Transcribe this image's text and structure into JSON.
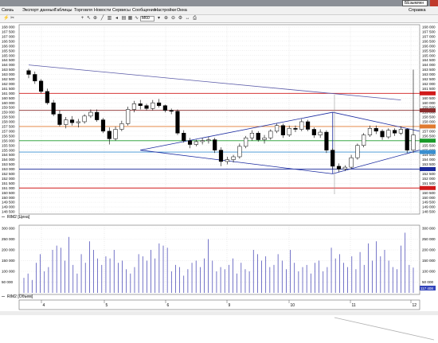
{
  "window": {
    "title": "БЕзымянн"
  },
  "menu": {
    "items": [
      "Связь",
      "Экспорт данных",
      "Таблицы",
      "Торговля",
      "Новости",
      "Сервисы",
      "Сообщения",
      "Настройки",
      "Окна"
    ],
    "right": "Справка"
  },
  "toolbar": {
    "timeframe": "M60"
  },
  "price_panel": {
    "label": "RIM2 [Цена]",
    "y_ticks": [
      "168 000",
      "167 500",
      "167 000",
      "166 500",
      "166 000",
      "165 500",
      "165 000",
      "164 500",
      "164 000",
      "163 500",
      "163 000",
      "162 500",
      "162 000",
      "161 500",
      "161 000",
      "160 500",
      "160 000",
      "159 500",
      "159 000",
      "158 500",
      "158 000",
      "157 500",
      "157 000",
      "156 500",
      "156 000",
      "155 500",
      "155 000",
      "154 500",
      "154 000",
      "153 500",
      "153 000",
      "152 500",
      "152 000",
      "151 500",
      "151 000",
      "150 500",
      "150 000",
      "149 500",
      "149 000",
      "148 500"
    ],
    "levels": [
      {
        "price": 161000,
        "color": "#d11a1a"
      },
      {
        "price": 159200,
        "color": "#8a2b2b"
      },
      {
        "price": 157500,
        "color": "#e07a30"
      },
      {
        "price": 156000,
        "color": "#1a9a2a"
      },
      {
        "price": 154800,
        "color": "#3a8fd0"
      },
      {
        "price": 153000,
        "color": "#1a2a9a"
      },
      {
        "price": 151000,
        "color": "#d11a1a"
      }
    ]
  },
  "volume_panel": {
    "label": "RIM2 [Объем]",
    "y_ticks": [
      "300 000",
      "250 000",
      "200 000",
      "150 000",
      "100 000",
      "50 000"
    ],
    "last_value": "117 408"
  },
  "date_axis": {
    "labels": [
      "4",
      "5",
      "6",
      "9",
      "10",
      "11",
      "12"
    ]
  },
  "chart_data": [
    {
      "type": "candlestick",
      "title": "",
      "series": [
        {
          "name": "RIM2 [Цена]"
        }
      ],
      "ylim": [
        148500,
        168000
      ],
      "candles": [
        [
          163400,
          163600,
          162600,
          163000
        ],
        [
          163000,
          163300,
          162000,
          162300
        ],
        [
          162300,
          162500,
          161000,
          161200
        ],
        [
          161200,
          161500,
          159800,
          160000
        ],
        [
          160000,
          160300,
          158600,
          158800
        ],
        [
          158800,
          159200,
          157500,
          157700
        ],
        [
          157700,
          158500,
          157300,
          158200
        ],
        [
          158200,
          158600,
          157600,
          157900
        ],
        [
          157900,
          158300,
          157400,
          158000
        ],
        [
          158000,
          158800,
          157800,
          158600
        ],
        [
          158600,
          159300,
          158400,
          159000
        ],
        [
          159000,
          159300,
          158000,
          158200
        ],
        [
          158200,
          158400,
          156800,
          157000
        ],
        [
          157000,
          157400,
          155600,
          156200
        ],
        [
          156200,
          157500,
          156000,
          157200
        ],
        [
          157200,
          158100,
          157000,
          157800
        ],
        [
          157800,
          159600,
          157600,
          159300
        ],
        [
          159300,
          160200,
          159000,
          159900
        ],
        [
          159900,
          160300,
          159300,
          159700
        ],
        [
          159700,
          159900,
          159200,
          159400
        ],
        [
          159400,
          160300,
          159200,
          160000
        ],
        [
          160000,
          160400,
          159500,
          159700
        ],
        [
          159700,
          159800,
          159000,
          159200
        ],
        [
          159200,
          159400,
          158800,
          159100
        ],
        [
          159100,
          159300,
          156600,
          156800
        ],
        [
          156800,
          157100,
          155800,
          156000
        ],
        [
          156000,
          156300,
          155200,
          155600
        ],
        [
          155600,
          156100,
          155400,
          155900
        ],
        [
          155900,
          156300,
          155600,
          156000
        ],
        [
          156000,
          156400,
          155700,
          156100
        ],
        [
          156100,
          156300,
          154700,
          155000
        ],
        [
          155000,
          155300,
          153300,
          153800
        ],
        [
          153800,
          154300,
          153500,
          154000
        ],
        [
          154000,
          154500,
          153700,
          154300
        ],
        [
          154300,
          155700,
          154100,
          155400
        ],
        [
          155400,
          156500,
          155200,
          156300
        ],
        [
          156300,
          157100,
          156000,
          156800
        ],
        [
          156800,
          157000,
          155900,
          156100
        ],
        [
          156100,
          156600,
          155700,
          156300
        ],
        [
          156300,
          157200,
          156100,
          157000
        ],
        [
          157000,
          157800,
          156800,
          157600
        ],
        [
          157600,
          157800,
          156300,
          156600
        ],
        [
          156600,
          157600,
          156400,
          157300
        ],
        [
          157300,
          157600,
          156900,
          157200
        ],
        [
          157200,
          158300,
          157000,
          158000
        ],
        [
          158000,
          158200,
          157000,
          157200
        ],
        [
          157200,
          157400,
          156300,
          156600
        ],
        [
          156600,
          157200,
          156300,
          156900
        ],
        [
          156900,
          157100,
          154700,
          155000
        ],
        [
          155000,
          155200,
          153000,
          153300
        ],
        [
          153300,
          153600,
          152700,
          153000
        ],
        [
          153000,
          153400,
          152800,
          153200
        ],
        [
          153200,
          154500,
          153000,
          154200
        ],
        [
          154200,
          155700,
          154000,
          155500
        ],
        [
          155500,
          156800,
          155300,
          156600
        ],
        [
          156600,
          157600,
          156400,
          157300
        ],
        [
          157300,
          157600,
          156700,
          157000
        ],
        [
          157000,
          157200,
          156100,
          156400
        ],
        [
          156400,
          157300,
          156200,
          157100
        ],
        [
          157100,
          157300,
          156500,
          156800
        ],
        [
          156800,
          157500,
          156600,
          157200
        ],
        [
          157200,
          157300,
          154700,
          155000
        ],
        [
          155000,
          163500,
          154700,
          156600
        ]
      ],
      "trend_lines": [
        {
          "from": [
            0,
            164000
          ],
          "to": [
            60,
            160300
          ]
        },
        {
          "from": [
            18,
            155000
          ],
          "to": [
            49,
            159000
          ]
        },
        {
          "from": [
            18,
            155000
          ],
          "to": [
            49,
            152500
          ]
        },
        {
          "from": [
            49,
            159000
          ],
          "to": [
            63,
            157000
          ]
        },
        {
          "from": [
            49,
            152500
          ],
          "to": [
            63,
            155000
          ]
        },
        {
          "from": [
            49,
            159000
          ],
          "to": [
            49,
            152500
          ]
        }
      ]
    },
    {
      "type": "bar",
      "title": "",
      "series": [
        {
          "name": "RIM2 [Объем]",
          "values": [
            70000,
            90000,
            60000,
            140000,
            180000,
            100000,
            120000,
            200000,
            220000,
            210000,
            150000,
            260000,
            130000,
            90000,
            180000,
            140000,
            240000,
            200000,
            160000,
            130000,
            170000,
            160000,
            200000,
            140000,
            150000,
            110000,
            90000,
            120000,
            180000,
            170000,
            150000,
            200000,
            160000,
            230000,
            220000,
            210000,
            100000,
            130000,
            120000,
            80000,
            110000,
            140000,
            150000,
            120000,
            160000,
            250000,
            150000,
            100000,
            120000,
            110000,
            130000,
            160000,
            90000,
            140000,
            110000,
            100000,
            200000,
            180000,
            150000,
            170000,
            120000,
            130000,
            180000,
            150000,
            110000,
            200000,
            140000,
            100000,
            120000,
            130000,
            90000,
            140000,
            150000,
            100000,
            120000,
            210000,
            160000,
            180000,
            140000,
            120000,
            170000,
            110000,
            190000,
            130000,
            230000,
            150000,
            240000,
            170000,
            200000,
            150000,
            120000,
            110000,
            220000,
            280000,
            130000,
            117408
          ]
        }
      ],
      "ylim": [
        0,
        300000
      ]
    }
  ]
}
